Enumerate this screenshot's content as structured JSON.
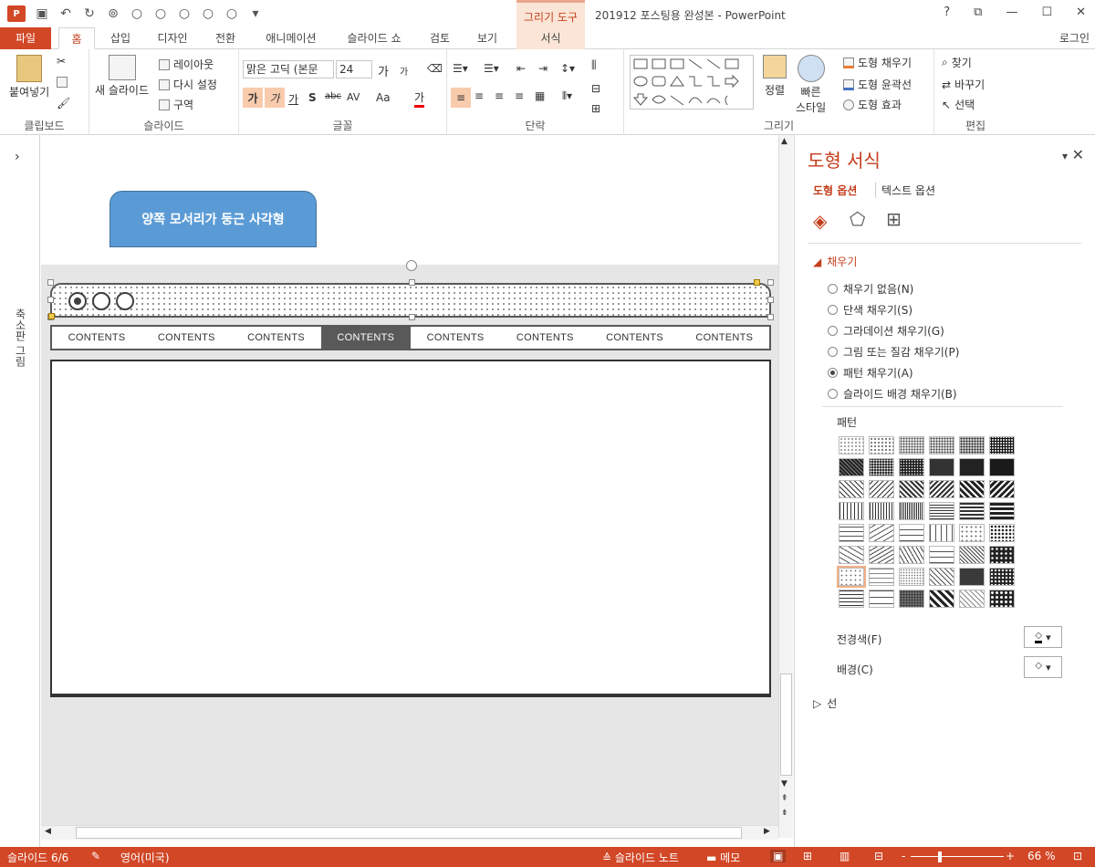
{
  "titlebar": {
    "context_tab": "그리기 도구",
    "doc_title": "201912 포스팅용 완성본 - PowerPoint",
    "help": "?",
    "restore": "⧉",
    "minimize": "—",
    "maximize": "☐",
    "close": "✕",
    "logo": "P"
  },
  "tabs": [
    {
      "label": "파일"
    },
    {
      "label": "홈"
    },
    {
      "label": "삽입"
    },
    {
      "label": "디자인"
    },
    {
      "label": "전환"
    },
    {
      "label": "애니메이션"
    },
    {
      "label": "슬라이드 쇼"
    },
    {
      "label": "검토"
    },
    {
      "label": "보기"
    },
    {
      "label": "서식"
    }
  ],
  "login": "로그인",
  "ribbon": {
    "clipboard": {
      "label": "클립보드",
      "paste": "붙여넣기"
    },
    "slides": {
      "label": "슬라이드",
      "new_slide": "새 슬라이드",
      "layout": "레이아웃",
      "reset": "다시 설정",
      "section": "구역"
    },
    "font": {
      "label": "글꼴",
      "font_name": "맑은 고딕 (본문",
      "font_size": "24",
      "grow": "가",
      "shrink": "가",
      "bold": "가",
      "italic": "가",
      "underline": "가",
      "shadow": "S",
      "strike": "abc",
      "spacing": "AV",
      "case": "Aa",
      "color": "가"
    },
    "paragraph": {
      "label": "단락"
    },
    "drawing": {
      "label": "그리기",
      "arrange": "정렬",
      "quick_styles": "빠른\n스타일",
      "fill": "도형 채우기",
      "outline": "도형 윤곽선",
      "effects": "도형 효과"
    },
    "editing": {
      "label": "편집",
      "find": "찾기",
      "replace": "바꾸기",
      "select": "선택"
    }
  },
  "left_rail": {
    "label": "축소판 그림",
    "expand": "›"
  },
  "slide": {
    "rounded_shape_text": "양쪽 모서리가 둥근 사각형",
    "nav_items": [
      "CONTENTS",
      "CONTENTS",
      "CONTENTS",
      "CONTENTS",
      "CONTENTS",
      "CONTENTS",
      "CONTENTS",
      "CONTENTS"
    ],
    "active_nav_index": 3
  },
  "pane": {
    "title": "도형 서식",
    "tab_shape": "도형 옵션",
    "tab_text": "텍스트 옵션",
    "fill_section": "채우기",
    "fill_options": [
      {
        "label": "채우기 없음(N)",
        "checked": false
      },
      {
        "label": "단색 채우기(S)",
        "checked": false
      },
      {
        "label": "그라데이션 채우기(G)",
        "checked": false
      },
      {
        "label": "그림 또는 질감 채우기(P)",
        "checked": false
      },
      {
        "label": "패턴 채우기(A)",
        "checked": true
      },
      {
        "label": "슬라이드 배경 채우기(B)",
        "checked": false
      }
    ],
    "pattern_label": "패턴",
    "foreground_label": "전경색(F)",
    "background_label": "배경(C)",
    "line_section": "선",
    "selected_pattern_index": 36,
    "close": "✕",
    "pin": "▾"
  },
  "status": {
    "slide": "슬라이드 6/6",
    "lang": "영어(미국)",
    "notes": "슬라이드 노트",
    "comments": "메모",
    "zoom": "66 %",
    "zoom_out": "-",
    "zoom_in": "+"
  }
}
